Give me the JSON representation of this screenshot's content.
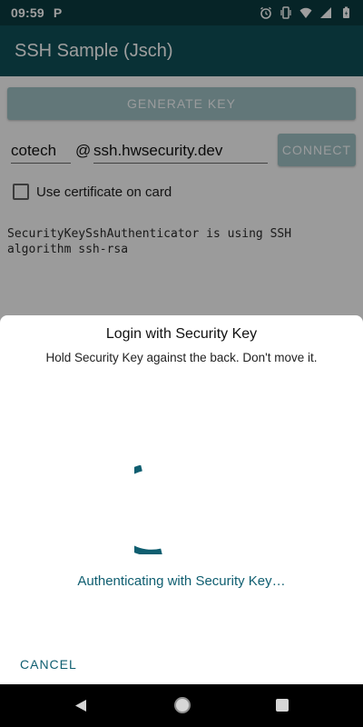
{
  "status_bar": {
    "time": "09:59",
    "notification_badge": "P",
    "icons": [
      "alarm-icon",
      "vibrate-icon",
      "wifi-icon",
      "signal-icon",
      "battery-icon"
    ]
  },
  "app_bar": {
    "title": "SSH Sample (Jsch)"
  },
  "main": {
    "generate_key_label": "GENERATE KEY",
    "username_value": "cotech",
    "at_symbol": "@",
    "host_value": "ssh.hwsecurity.dev",
    "connect_label": "CONNECT",
    "checkbox_label": "Use certificate on card",
    "checkbox_checked": false,
    "log_text": "SecurityKeySshAuthenticator is using SSH\nalgorithm ssh-rsa"
  },
  "dialog": {
    "title": "Login with Security Key",
    "description": "Hold Security Key against the back. Don't move it.",
    "status": "Authenticating with Security Key…",
    "cancel_label": "CANCEL",
    "accent_color": "#0f5e70"
  },
  "nav_bar": {
    "icons": [
      "back-icon",
      "home-icon",
      "recents-icon"
    ]
  },
  "colors": {
    "app_bar": "#0f4f57",
    "status_bar": "#0b3a3f",
    "button_disabled": "#9fc0c4",
    "accent": "#0f5e70"
  }
}
